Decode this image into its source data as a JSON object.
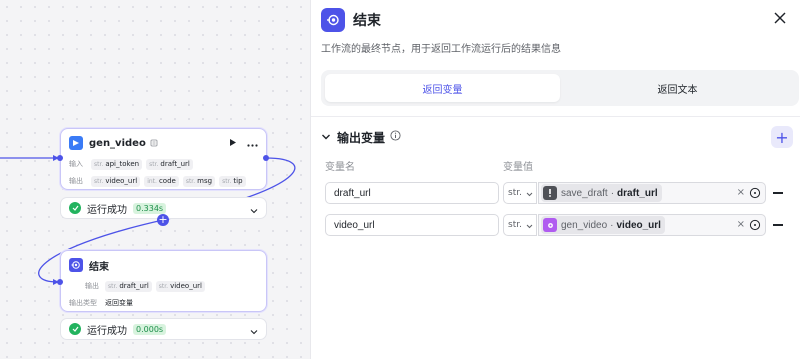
{
  "canvas": {
    "node_gen_video": {
      "title": "gen_video",
      "input_label": "输入",
      "output_label": "输出",
      "inputs": [
        {
          "type": "str.",
          "name": "api_token"
        },
        {
          "type": "str.",
          "name": "draft_url"
        }
      ],
      "outputs": [
        {
          "type": "str.",
          "name": "video_url"
        },
        {
          "type": "int.",
          "name": "code"
        },
        {
          "type": "str.",
          "name": "msg"
        },
        {
          "type": "str.",
          "name": "tip"
        }
      ],
      "status_text": "运行成功",
      "status_time": "0.334s"
    },
    "node_end": {
      "title": "结束",
      "output_label": "输出",
      "outputs": [
        {
          "type": "str.",
          "name": "draft_url"
        },
        {
          "type": "str.",
          "name": "video_url"
        }
      ],
      "output_type_label": "输出类型",
      "output_type_value": "返回变量",
      "status_text": "运行成功",
      "status_time": "0.000s"
    },
    "colors": {
      "accent": "#4d53e8",
      "success": "#23b35f"
    }
  },
  "panel": {
    "title": "结束",
    "description": "工作流的最终节点，用于返回工作流运行后的结果信息",
    "tabs": [
      {
        "label": "返回变量",
        "active": true
      },
      {
        "label": "返回文本",
        "active": false
      }
    ],
    "section_title": "输出变量",
    "col_name": "变量名",
    "col_value": "变量值",
    "rows": [
      {
        "name": "draft_url",
        "type": "str.",
        "ref_node": "save_draft",
        "ref_var": "draft_url",
        "ref_icon": "alert-icon"
      },
      {
        "name": "video_url",
        "type": "str.",
        "ref_node": "gen_video",
        "ref_var": "video_url",
        "ref_icon": "plugin-icon"
      }
    ]
  }
}
